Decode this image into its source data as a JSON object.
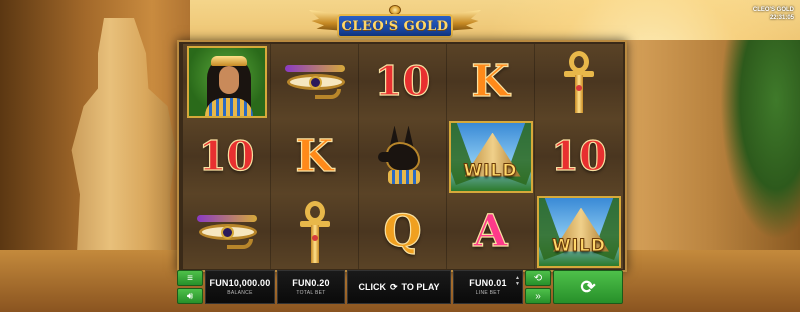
{
  "game": {
    "title": "CLEO'S GOLD",
    "corner_title": "CLEO'S GOLD",
    "clock": "22:31:05"
  },
  "reels": [
    [
      "cleopatra",
      "ten",
      "eye-of-horus"
    ],
    [
      "eye-of-horus",
      "king",
      "ankh"
    ],
    [
      "ten",
      "anubis",
      "queen"
    ],
    [
      "king",
      "wild",
      "ace"
    ],
    [
      "ankh",
      "ten",
      "wild"
    ]
  ],
  "symbols": {
    "ten": "10",
    "king": "K",
    "queen": "Q",
    "ace": "A",
    "wild": "WILD"
  },
  "controls": {
    "balance_value": "FUN10,000.00",
    "balance_label": "BALANCE",
    "total_bet_value": "FUN0.20",
    "total_bet_label": "TOTAL BET",
    "play_text_left": "CLICK",
    "play_text_right": "TO PLAY",
    "line_bet_value": "FUN0.01",
    "line_bet_label": "LINE BET",
    "menu_icon": "menu-icon",
    "sound_icon": "sound-icon",
    "autoplay_icon": "autoplay-icon",
    "turbo_icon": "fast-forward-icon",
    "spin_icon": "spin-icon"
  },
  "colors": {
    "button_green": "#27902a",
    "panel_black": "#0a0a0a",
    "frame_gold": "#b98a40"
  }
}
